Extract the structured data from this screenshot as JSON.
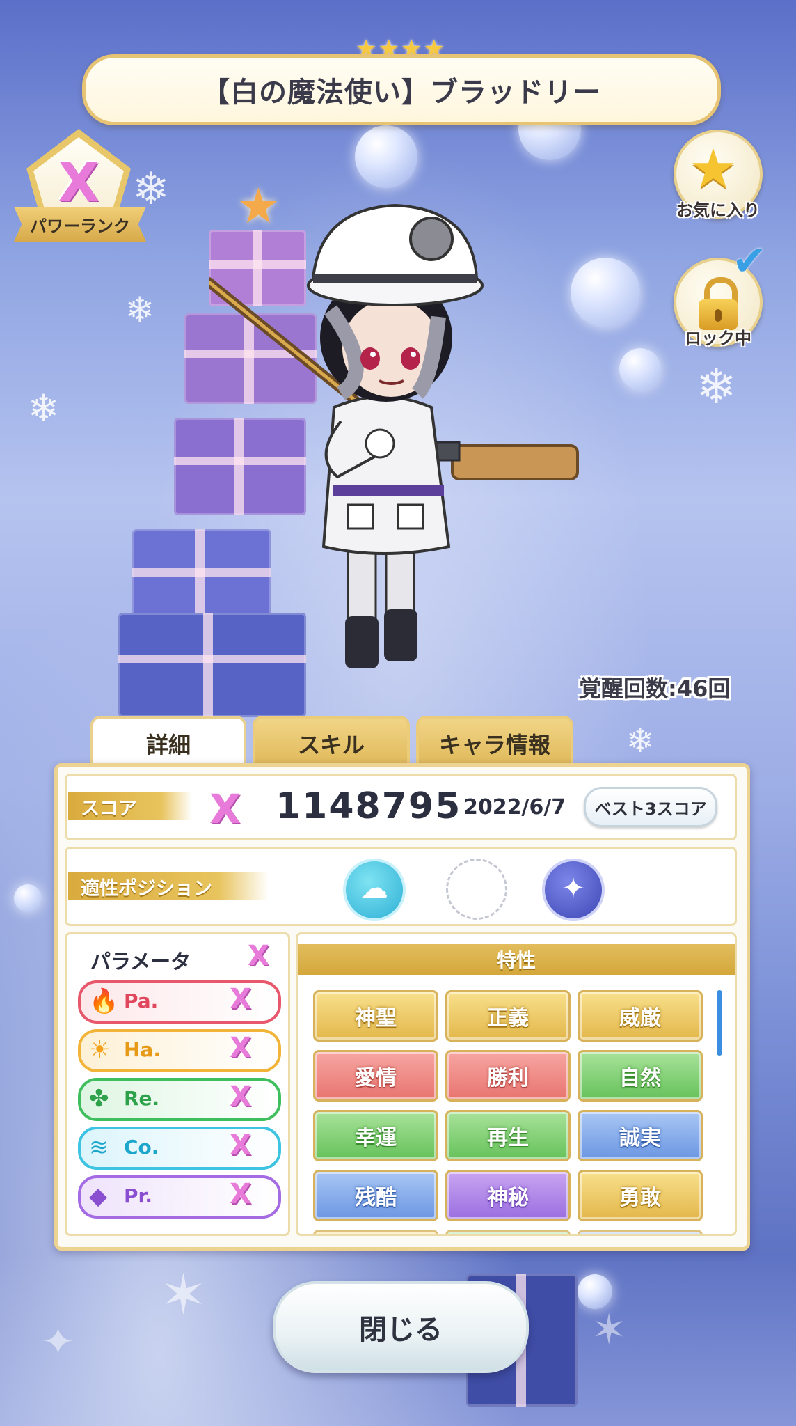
{
  "card": {
    "title": "【白の魔法使い】ブラッドリー",
    "rarity_stars": [
      "★",
      "★",
      "★",
      "★"
    ]
  },
  "power_rank": {
    "rank_glyph": "X",
    "label": "パワーランク"
  },
  "side_buttons": {
    "favorite_label": "お気に入り",
    "lock_label": "ロック中",
    "lock_checked": true
  },
  "awakening": {
    "text": "覚醒回数:46回"
  },
  "tabs": [
    {
      "label": "詳細",
      "active": true
    },
    {
      "label": "スキル",
      "active": false
    },
    {
      "label": "キャラ情報",
      "active": false
    }
  ],
  "score": {
    "label": "スコア",
    "rank_glyph": "X",
    "value": "1148795",
    "date": "2022/6/7",
    "best3_button": "ベスト3スコア"
  },
  "position": {
    "label": "適性ポジション",
    "icons": [
      "cloud-icon",
      "empty-slot",
      "fish-icon"
    ]
  },
  "parameters": {
    "title": "パラメータ",
    "title_rank": "X",
    "items": [
      {
        "name": "Pa.",
        "rank": "X",
        "icon": "fire-icon",
        "icon_glyph": "🔥"
      },
      {
        "name": "Ha.",
        "rank": "X",
        "icon": "sun-icon",
        "icon_glyph": "☀"
      },
      {
        "name": "Re.",
        "rank": "X",
        "icon": "clover-icon",
        "icon_glyph": "✤"
      },
      {
        "name": "Co.",
        "rank": "X",
        "icon": "wave-icon",
        "icon_glyph": "≋"
      },
      {
        "name": "Pr.",
        "rank": "X",
        "icon": "diamond-icon",
        "icon_glyph": "◆"
      }
    ]
  },
  "traits": {
    "title": "特性",
    "items": [
      {
        "label": "神聖",
        "color": "gold"
      },
      {
        "label": "正義",
        "color": "gold"
      },
      {
        "label": "威厳",
        "color": "gold"
      },
      {
        "label": "愛情",
        "color": "red"
      },
      {
        "label": "勝利",
        "color": "red"
      },
      {
        "label": "自然",
        "color": "green"
      },
      {
        "label": "幸運",
        "color": "green"
      },
      {
        "label": "再生",
        "color": "green"
      },
      {
        "label": "誠実",
        "color": "blue"
      },
      {
        "label": "残酷",
        "color": "blue"
      },
      {
        "label": "神秘",
        "color": "purple"
      },
      {
        "label": "勇敢",
        "color": "gold"
      }
    ]
  },
  "close_button": "閉じる",
  "colors": {
    "gold_border": "#ecd391",
    "accent_pink": "#e87ad9",
    "scroll_accent": "#3a8fe0"
  }
}
